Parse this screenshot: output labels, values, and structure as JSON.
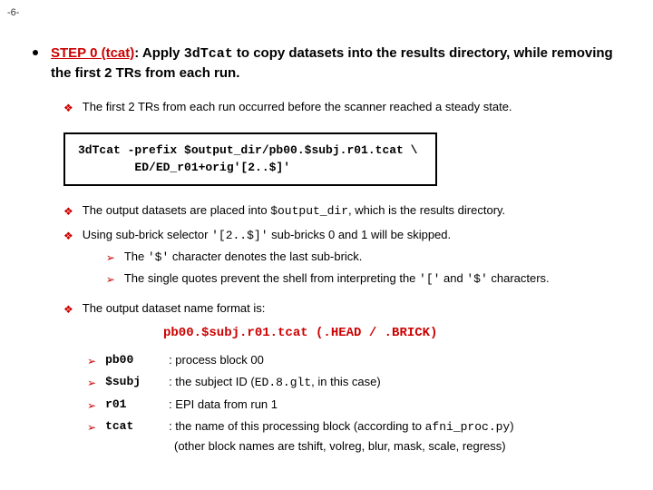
{
  "page_number": "-6-",
  "main": {
    "step_label": "STEP 0 (tcat)",
    "sep": ": Apply ",
    "cmd": "3dTcat",
    "rest": " to copy datasets into the results directory, while removing the first 2 TRs from each run."
  },
  "sub1": "The first 2 TRs from each run occurred before the scanner reached a steady state.",
  "codebox": {
    "l1": "3dTcat -prefix $output_dir/pb00.$subj.r01.tcat  \\",
    "l2": "        ED/ED_r01+orig'[2..$]'"
  },
  "sub2": {
    "pre": "The output datasets are placed into ",
    "code": "$output_dir",
    "post": ", which is the results directory."
  },
  "sub3": {
    "pre": "Using sub-brick selector ",
    "code": "'[2..$]'",
    "post": " sub-bricks 0 and 1 will be skipped."
  },
  "sub3a": {
    "pre": "The ",
    "code": "'$'",
    "post": " character denotes the last sub-brick."
  },
  "sub3b": {
    "pre": "The single quotes prevent the shell from interpreting the ",
    "code1": "'['",
    "mid": " and ",
    "code2": "'$'",
    "post": " characters."
  },
  "sub4": "The output dataset name format is:",
  "format_line": "pb00.$subj.r01.tcat (.HEAD / .BRICK)",
  "rows": [
    {
      "key": "pb00",
      "desc_pre": ": process block 00",
      "code": "",
      "desc_post": ""
    },
    {
      "key": "$subj",
      "desc_pre": ": the subject ID (",
      "code": "ED.8.glt",
      "desc_post": ", in this case)"
    },
    {
      "key": "r01",
      "desc_pre": ": EPI data from run 1",
      "code": "",
      "desc_post": ""
    },
    {
      "key": "tcat",
      "desc_pre": ": the name of this processing block (according to ",
      "code": "afni_proc.py",
      "desc_post": ")"
    }
  ],
  "footer_note": "(other block names are tshift, volreg, blur, mask, scale, regress)"
}
